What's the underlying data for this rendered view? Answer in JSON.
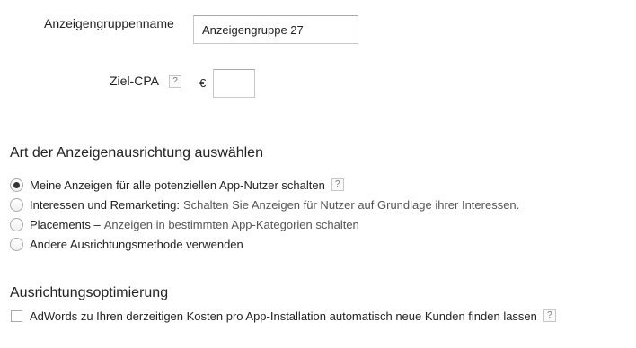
{
  "adgroup_name": {
    "label": "Anzeigengruppenname",
    "value": "Anzeigengruppe 27"
  },
  "target_cpa": {
    "label": "Ziel-CPA",
    "help": "?",
    "currency": "€",
    "value": ""
  },
  "targeting": {
    "title": "Art der Anzeigenausrichtung auswählen",
    "options": [
      {
        "label": "Meine Anzeigen für alle potenziellen App-Nutzer schalten",
        "sub": "",
        "help": "?",
        "selected": true
      },
      {
        "label": "Interessen und Remarketing:",
        "sub": "Schalten Sie Anzeigen für Nutzer auf Grundlage ihrer Interessen.",
        "selected": false
      },
      {
        "label": "Placements –",
        "sub": "Anzeigen in bestimmten App-Kategorien schalten",
        "selected": false
      },
      {
        "label": "Andere Ausrichtungsmethode verwenden",
        "sub": "",
        "selected": false
      }
    ]
  },
  "optimization": {
    "title": "Ausrichtungsoptimierung",
    "checkbox_label": "AdWords zu Ihren derzeitigen Kosten pro App-Installation automatisch neue Kunden finden lassen",
    "help": "?",
    "checked": false
  }
}
